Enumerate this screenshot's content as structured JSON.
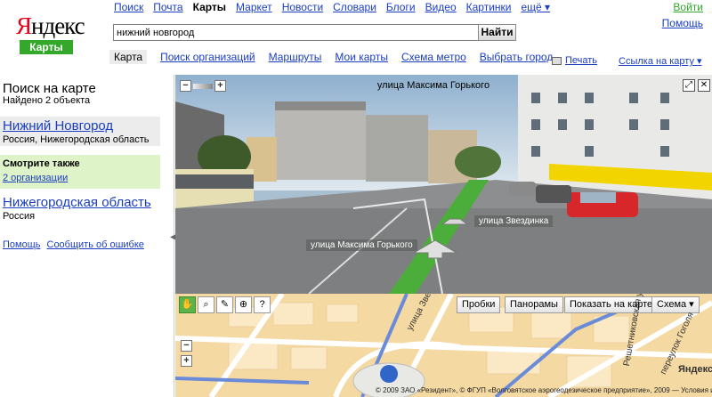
{
  "logo": {
    "wordmark": "Яндекс",
    "service": "Карты"
  },
  "topnav": [
    {
      "label": "Поиск",
      "active": false
    },
    {
      "label": "Почта",
      "active": false
    },
    {
      "label": "Карты",
      "active": true
    },
    {
      "label": "Маркет",
      "active": false
    },
    {
      "label": "Новости",
      "active": false
    },
    {
      "label": "Словари",
      "active": false
    },
    {
      "label": "Блоги",
      "active": false
    },
    {
      "label": "Видео",
      "active": false
    },
    {
      "label": "Картинки",
      "active": false
    },
    {
      "label": "ещё ▾",
      "active": false
    }
  ],
  "account": {
    "login": "Войти",
    "help": "Помощь"
  },
  "search": {
    "value": "нижний новгород",
    "button": "Найти"
  },
  "subnav": {
    "tabs": [
      "Карта",
      "Поиск организаций",
      "Маршруты",
      "Мои карты",
      "Схема метро",
      "Выбрать город"
    ],
    "print": "Печать",
    "map_link": "Ссылка на карту ▾"
  },
  "left_panel": {
    "title": "Поиск на карте",
    "found": "Найдено 2 объекта",
    "results": [
      {
        "name": "Нижний Новгород",
        "sub": "Россия, Нижегородская область"
      },
      {
        "name": "Нижегородская область",
        "sub": "Россия"
      }
    ],
    "see_also": {
      "title": "Смотрите также",
      "link": "2 организации"
    },
    "footer": {
      "help": "Помощь",
      "report": "Сообщить об ошибке"
    },
    "collapse_glyph": "◀"
  },
  "panorama": {
    "street_title": "улица Максима Горького",
    "labels": {
      "street_a": "улица Звездинка",
      "street_b": "улица Максима Горького"
    },
    "expand_glyph": "⤢",
    "close_glyph": "✕",
    "zoom_out": "−",
    "zoom_in": "+"
  },
  "map": {
    "tools": [
      "✋",
      "⌕",
      "✎",
      "⊕",
      "?"
    ],
    "buttons": {
      "traffic": "Пробки",
      "panoramas": "Панорамы",
      "show_on_map": "Показать на карте ▾",
      "layer": "Схема ▾"
    },
    "zoom_in": "+",
    "zoom_out": "−",
    "copyright": "© 2009 ЗАО «Резидент», © ФГУП «Волговятское аэрогеодезическое предприятие», 2009 — Условия использования",
    "brand": "Яндекс",
    "street_labels": [
      "улица Звездинка",
      "Решетниковская ул.",
      "переулок Гоголя"
    ]
  },
  "colors": {
    "logo_red": "#e2001a",
    "brand_green": "#34a82a",
    "link_blue": "#1a3dc1",
    "highlight_green": "#dff3c8"
  }
}
